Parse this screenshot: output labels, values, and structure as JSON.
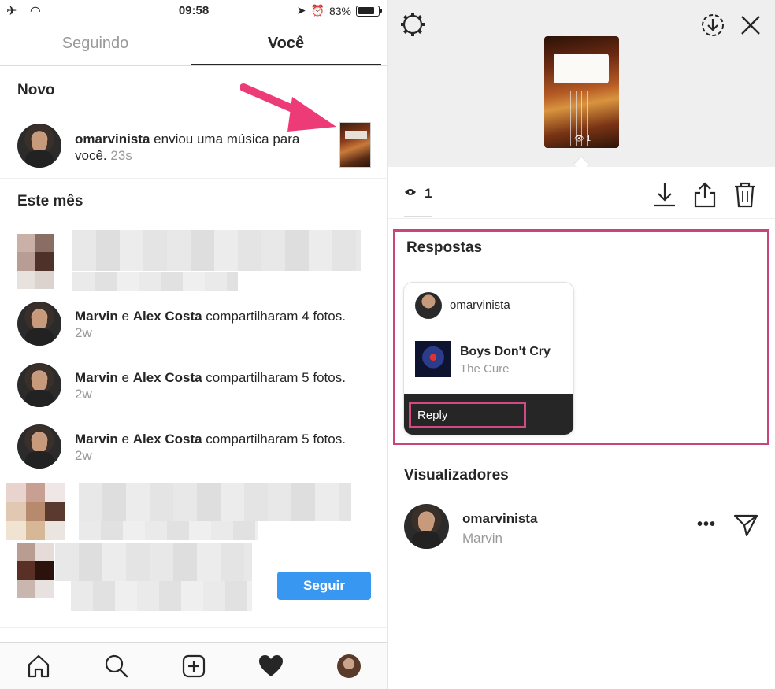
{
  "status": {
    "time": "09:58",
    "battery": "83%"
  },
  "left": {
    "tabs": [
      {
        "label": "Seguindo"
      },
      {
        "label": "Você"
      }
    ],
    "new_section": "Novo",
    "new_notification": {
      "user": "omarvinista",
      "text": " enviou uma música para você. ",
      "time": "23s"
    },
    "month_section": "Este mês",
    "notifications": [
      {
        "u1": "Marvin",
        "and": " e ",
        "u2": "Alex Costa",
        "text": " compartilharam 4 fotos. ",
        "time": "2w"
      },
      {
        "u1": "Marvin",
        "and": " e ",
        "u2": "Alex Costa",
        "text": " compartilharam 5 fotos. ",
        "time": "2w"
      },
      {
        "u1": "Marvin",
        "and": " e ",
        "u2": "Alex Costa",
        "text": " compartilharam 5 fotos. ",
        "time": "2w"
      }
    ],
    "follow_button": "Seguir",
    "nav": [
      "home-icon",
      "search-icon",
      "add-icon",
      "heart-icon",
      "profile"
    ]
  },
  "right": {
    "views_count": "1",
    "replies_title": "Respostas",
    "reply": {
      "user": "omarvinista",
      "song": "Boys Don't Cry",
      "artist": "The Cure",
      "button": "Reply"
    },
    "viewers_title": "Visualizadores",
    "viewer": {
      "user": "omarvinista",
      "name": "Marvin"
    },
    "story_views": "1"
  },
  "colors": {
    "highlight": "#c8457a",
    "follow": "#3897f0",
    "arrow": "#ec3b77"
  }
}
